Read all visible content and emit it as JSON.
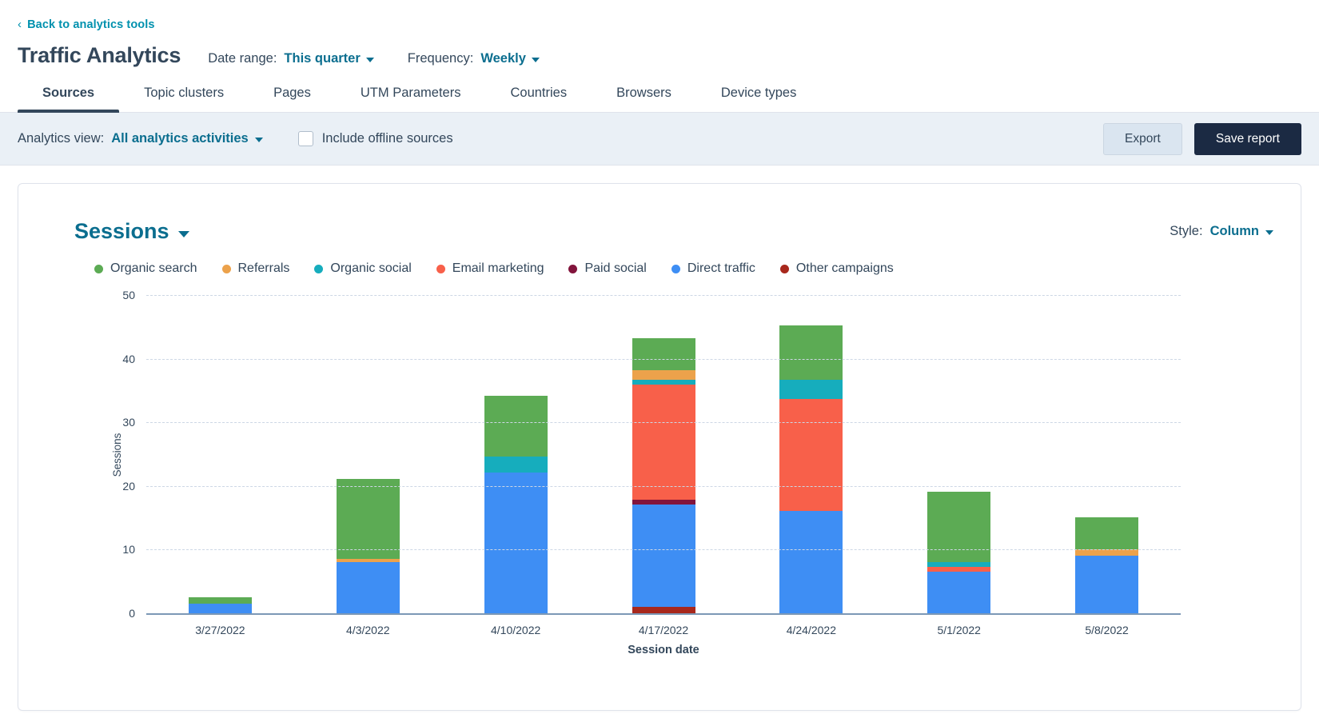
{
  "header": {
    "back_label": "Back to analytics tools",
    "back_icon": "chevron-left-icon",
    "title": "Traffic Analytics",
    "date_range_label": "Date range:",
    "date_range_value": "This quarter",
    "frequency_label": "Frequency:",
    "frequency_value": "Weekly"
  },
  "tabs": [
    {
      "label": "Sources",
      "active": true
    },
    {
      "label": "Topic clusters",
      "active": false
    },
    {
      "label": "Pages",
      "active": false
    },
    {
      "label": "UTM Parameters",
      "active": false
    },
    {
      "label": "Countries",
      "active": false
    },
    {
      "label": "Browsers",
      "active": false
    },
    {
      "label": "Device types",
      "active": false
    }
  ],
  "filterbar": {
    "analytics_view_label": "Analytics view:",
    "analytics_view_value": "All analytics activities",
    "offline_checkbox_label": "Include offline sources",
    "offline_checked": false,
    "export_label": "Export",
    "save_label": "Save report"
  },
  "card": {
    "metric": "Sessions",
    "style_label": "Style:",
    "style_value": "Column"
  },
  "colors": {
    "organic_search": "#5cab54",
    "referrals": "#eca24b",
    "organic_social": "#16adbd",
    "email_marketing": "#f8604a",
    "paid_social": "#82143c",
    "direct_traffic": "#3e8ef4",
    "other_campaigns": "#a8281c",
    "link": "#0b6e8f",
    "back_link": "#0091ae",
    "dark": "#33475b",
    "save_button": "#1b2a43",
    "filter_bg": "#eaf0f6"
  },
  "chart_data": {
    "type": "bar",
    "stacked": true,
    "title": "Sessions",
    "xlabel": "Session date",
    "ylabel": "Sessions",
    "ylim": [
      0,
      50
    ],
    "yticks": [
      0,
      10,
      20,
      30,
      40,
      50
    ],
    "grid": true,
    "legend_position": "top-left",
    "categories": [
      "3/27/2022",
      "4/3/2022",
      "4/10/2022",
      "4/17/2022",
      "4/24/2022",
      "5/1/2022",
      "5/8/2022"
    ],
    "series": [
      {
        "name": "Other campaigns",
        "color": "#a8281c",
        "values": [
          0,
          0,
          0,
          1,
          0,
          0,
          0
        ]
      },
      {
        "name": "Direct traffic",
        "color": "#3e8ef4",
        "values": [
          1.5,
          8,
          22,
          16,
          16,
          6.5,
          9
        ]
      },
      {
        "name": "Paid social",
        "color": "#82143c",
        "values": [
          0,
          0,
          0,
          0.7,
          0,
          0,
          0
        ]
      },
      {
        "name": "Email marketing",
        "color": "#f8604a",
        "values": [
          0,
          0,
          0,
          18,
          17.5,
          0.7,
          0
        ]
      },
      {
        "name": "Organic social",
        "color": "#16adbd",
        "values": [
          0,
          0,
          2.5,
          0.8,
          3,
          0.8,
          0
        ]
      },
      {
        "name": "Referrals",
        "color": "#eca24b",
        "values": [
          0,
          0.5,
          0,
          1.5,
          0,
          0,
          1
        ]
      },
      {
        "name": "Organic search",
        "color": "#5cab54",
        "values": [
          1,
          12.5,
          9.5,
          5,
          8.5,
          11,
          5
        ]
      }
    ],
    "totals": [
      2.5,
      21,
      34,
      43,
      45,
      19,
      15
    ]
  }
}
